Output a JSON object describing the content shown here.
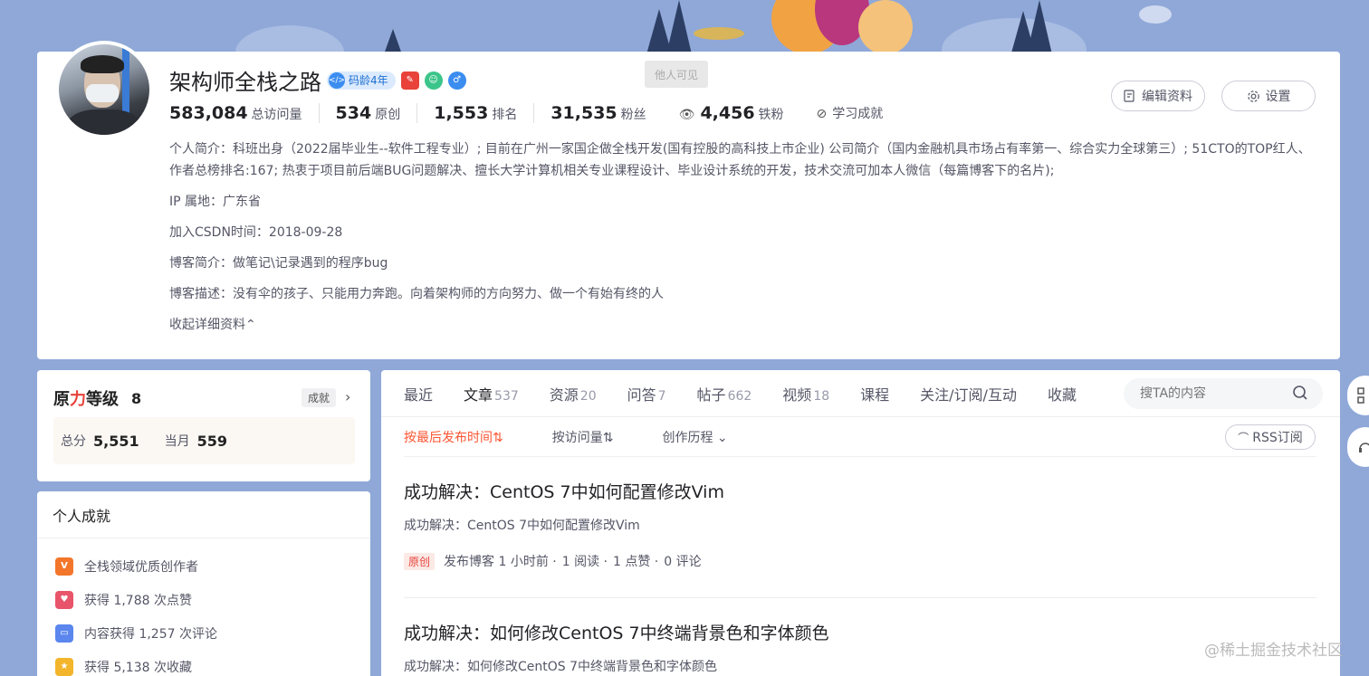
{
  "profile": {
    "name": "架构师全栈之路",
    "code_age_badge": "码龄4年",
    "tooltip": "他人可见",
    "stats": [
      {
        "value": "583,084",
        "label": "总访问量"
      },
      {
        "value": "534",
        "label": "原创"
      },
      {
        "value": "1,553",
        "label": "排名"
      },
      {
        "value": "31,535",
        "label": "粉丝"
      },
      {
        "value": "4,456",
        "label": "铁粉"
      }
    ],
    "learning_achievement": "学习成就",
    "edit_button": "编辑资料",
    "settings_button": "设置",
    "intro": "个人简介：科班出身（2022届毕业生--软件工程专业）; 目前在广州一家国企做全栈开发(国有控股的高科技上市企业) 公司简介（国内金融机具市场占有率第一、综合实力全球第三）; 51CTO的TOP红人、作者总榜排名:167; 热衷于项目前后端BUG问题解决、擅长大学计算机相关专业课程设计、毕业设计系统的开发，技术交流可加本人微信（每篇博客下的名片);",
    "ip_location": "IP 属地：广东省",
    "join_time": "加入CSDN时间：2018-09-28",
    "blog_intro": "博客简介：做笔记\\记录遇到的程序bug",
    "blog_desc": "博客描述：没有伞的孩子、只能用力奔跑。向着架构师的方向努力、做一个有始有终的人",
    "collapse_label": "收起详细资料⌃"
  },
  "level": {
    "title_prefix": "原",
    "title_red": "力",
    "title_suffix": "等级",
    "level": "8",
    "achievement_tag": "成就",
    "total_label": "总分",
    "total_value": "5,551",
    "month_label": "当月",
    "month_value": "559"
  },
  "achievements": {
    "header": "个人成就",
    "items": [
      {
        "icon": "v-badge-icon",
        "text": "全栈领域优质创作者",
        "color": "#f3762b"
      },
      {
        "icon": "like-icon",
        "text": "获得 1,788 次点赞",
        "color": "#e8546a"
      },
      {
        "icon": "comment-icon",
        "text": "内容获得 1,257 次评论",
        "color": "#5a86ee"
      },
      {
        "icon": "star-icon",
        "text": "获得 5,138 次收藏",
        "color": "#f3b52b"
      }
    ]
  },
  "tabs": [
    {
      "label": "最近",
      "count": ""
    },
    {
      "label": "文章",
      "count": "537"
    },
    {
      "label": "资源",
      "count": "20"
    },
    {
      "label": "问答",
      "count": "7"
    },
    {
      "label": "帖子",
      "count": "662"
    },
    {
      "label": "视频",
      "count": "18"
    },
    {
      "label": "课程",
      "count": ""
    },
    {
      "label": "关注/订阅/互动",
      "count": ""
    },
    {
      "label": "收藏",
      "count": ""
    }
  ],
  "search": {
    "placeholder": "搜TA的内容"
  },
  "sort": {
    "by_time": "按最后发布时间⇅",
    "by_visits": "按访问量⇅",
    "history": "创作历程 ⌄",
    "rss": "RSS订阅"
  },
  "articles": [
    {
      "title": "成功解决：CentOS 7中如何配置修改Vim",
      "summary": "成功解决：CentOS 7中如何配置修改Vim",
      "tag": "原创",
      "published": "发布博客 1 小时前 ·",
      "reads": "1 阅读 ·",
      "likes": "1 点赞 ·",
      "comments": "0 评论"
    },
    {
      "title": "成功解决：如何修改CentOS 7中终端背景色和字体颜色",
      "summary": "成功解决：如何修改CentOS 7中终端背景色和字体颜色"
    }
  ],
  "watermark": "@稀土掘金技术社区",
  "colors": {
    "accent": "#fc5531",
    "page_bg": "#8fa8d8"
  }
}
